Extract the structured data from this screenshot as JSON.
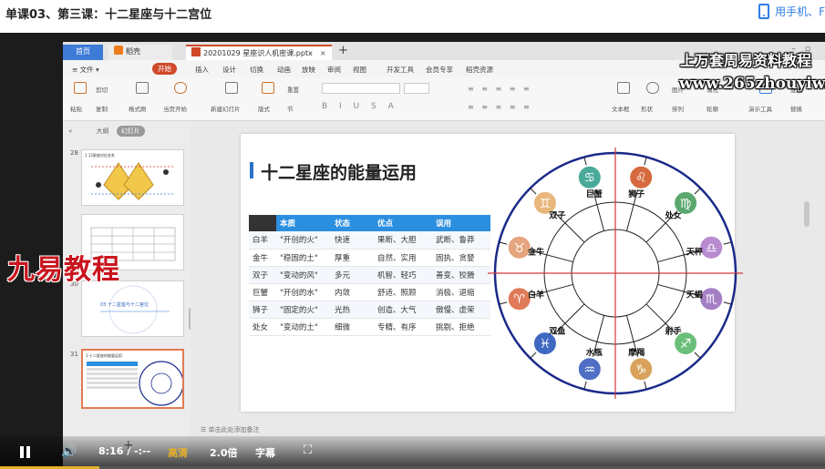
{
  "page": {
    "title": "单课03、第三课：十二星座与十二宫位",
    "mobile_link": "用手机、F"
  },
  "wps": {
    "tabs": {
      "home": "首页",
      "daoke": "稻壳",
      "file": "20201029 星座识人机密课.pptx",
      "close": "×",
      "add": "+"
    },
    "menu": [
      "≡ 文件 ▾",
      "开始",
      "插入",
      "设计",
      "切换",
      "动画",
      "放映",
      "审阅",
      "视图",
      "开发工具",
      "会员专享",
      "稻壳资源"
    ],
    "menu_active": "开始",
    "ribbon": {
      "paste": "粘贴",
      "cut": "剪切",
      "copy": "复制",
      "format_painter": "格式刷",
      "from_current": "当页开始",
      "new_slide": "新建幻灯片",
      "layout": "版式",
      "section": "节",
      "reset": "重置",
      "textbox": "文本框",
      "shapes": "形状",
      "arrange": "排列",
      "picture": "图片",
      "fill": "填充",
      "outline": "轮廓",
      "slide_tools": "演示工具",
      "find": "查找",
      "replace": "替换"
    },
    "watermark_top": "上万套周易资料教程",
    "watermark_url": "www.265zhouyiw.com",
    "brand_watermark": "九易教程",
    "left_panel": {
      "tab_outline": "大纲",
      "tab_slides": "幻灯片",
      "thumbs": [
        {
          "num": "28",
          "caption": "1 12星座对应关系"
        },
        {
          "num": "29",
          "caption": ""
        },
        {
          "num": "30",
          "caption": "03 十二星座与十二宫位"
        },
        {
          "num": "31",
          "caption": "1 十二星座的能量运用"
        }
      ],
      "add": "+"
    },
    "notes_placeholder": "单击此处添加备注"
  },
  "slide": {
    "title": "十二星座的能量运用",
    "table": {
      "headers": [
        "",
        "本质",
        "状态",
        "优点",
        "误用"
      ],
      "rows": [
        [
          "白羊",
          "\"开创的火\"",
          "快速",
          "果断、大胆",
          "武断、鲁莽"
        ],
        [
          "金牛",
          "\"稳固的土\"",
          "厚重",
          "自然、实用",
          "固执、贪婪"
        ],
        [
          "双子",
          "\"变动的风\"",
          "多元",
          "机智、轻巧",
          "善变、狡猾"
        ],
        [
          "巨蟹",
          "\"开创的水\"",
          "内敛",
          "舒适、照顾",
          "消极、退缩"
        ],
        [
          "狮子",
          "\"固定的火\"",
          "光热",
          "创造、大气",
          "傲慢、虚荣"
        ],
        [
          "处女",
          "\"变动的土\"",
          "细微",
          "专精、有序",
          "挑剔、拒绝"
        ]
      ]
    },
    "wheel": {
      "signs": [
        {
          "name": "白羊",
          "glyph": "♈",
          "color": "#e07b5a"
        },
        {
          "name": "金牛",
          "glyph": "♉",
          "color": "#e5a57e"
        },
        {
          "name": "双子",
          "glyph": "♊",
          "color": "#e9b67e"
        },
        {
          "name": "巨蟹",
          "glyph": "♋",
          "color": "#4aaa9a"
        },
        {
          "name": "狮子",
          "glyph": "♌",
          "color": "#d66a3e"
        },
        {
          "name": "处女",
          "glyph": "♍",
          "color": "#5aa86e"
        },
        {
          "name": "天秤",
          "glyph": "♎",
          "color": "#b88bd0"
        },
        {
          "name": "天蝎",
          "glyph": "♏",
          "color": "#a57fc6"
        },
        {
          "name": "射手",
          "glyph": "♐",
          "color": "#6bbf7a"
        },
        {
          "name": "摩羯",
          "glyph": "♑",
          "color": "#d9a35e"
        },
        {
          "name": "水瓶",
          "glyph": "♒",
          "color": "#4f6fc4"
        },
        {
          "name": "双鱼",
          "glyph": "♓",
          "color": "#3f69c0"
        }
      ],
      "ring_color": "#1a2a8a",
      "axis_color": "#d23a3a"
    }
  },
  "player": {
    "time": "8:16 / -:--",
    "quality": "高清",
    "speed": "2.0倍",
    "subtitles": "字幕",
    "progress": 0.12
  }
}
